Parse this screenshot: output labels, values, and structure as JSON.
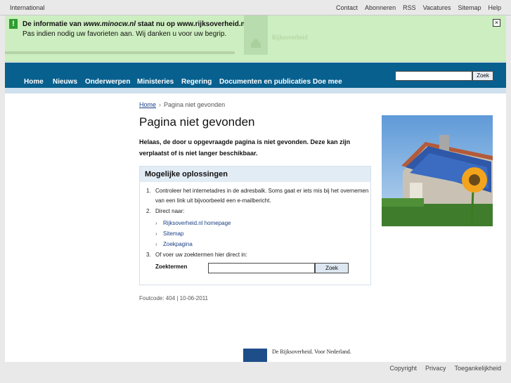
{
  "topbar": {
    "international": "International",
    "links": [
      "Contact",
      "Abonneren",
      "RSS",
      "Vacatures",
      "Sitemap",
      "Help"
    ]
  },
  "notice": {
    "icon": "!",
    "line1_prefix": "De informatie van ",
    "line1_old": "www.minocw.nl",
    "line1_mid": " staat nu op ",
    "line1_new": "www.rijksoverheid.nl.",
    "line2": "Pas indien nodig uw favorieten aan. Wij danken u voor uw begrip.",
    "close": "×",
    "brand": "Rijksoverheid"
  },
  "nav": {
    "items": [
      "Home",
      "Nieuws",
      "Onderwerpen",
      "Ministeries",
      "Regering",
      "Documenten en publicaties",
      "Doe mee"
    ],
    "search_value": "",
    "search_button": "Zoek"
  },
  "breadcrumb": {
    "home": "Home",
    "separator": "›",
    "current": "Pagina niet gevonden"
  },
  "title": "Pagina niet gevonden",
  "intro": "Helaas, de door u opgevraagde pagina is niet gevonden. Deze kan zijn verplaatst of is niet langer beschikbaar.",
  "solutions": {
    "heading": "Mogelijke oplossingen",
    "step1_num": "1.",
    "step1": "Controleer het internetadres in de adresbalk. Soms gaat er iets mis bij het overnemen van een link uit bijvoorbeeld een e-mailbericht.",
    "step2_num": "2.",
    "step2": "Direct naar:",
    "links": [
      "Rijksoverheid.nl homepage",
      "Sitemap",
      "Zoekpagina"
    ],
    "step3_num": "3.",
    "step3": "Of voer uw zoektermen hier direct in:",
    "search_label": "Zoektermen",
    "search_value": "",
    "search_button": "Zoek"
  },
  "foutcode": "Foutcode: 404 | 10-06-2011",
  "footer": {
    "tagline": "De Rijksoverheid. Voor Nederland.",
    "links": [
      "Copyright",
      "Privacy",
      "Toegankelijkheid"
    ]
  },
  "colors": {
    "nav": "#08608e",
    "notice": "#cdeec0",
    "link": "#1a3f86"
  }
}
